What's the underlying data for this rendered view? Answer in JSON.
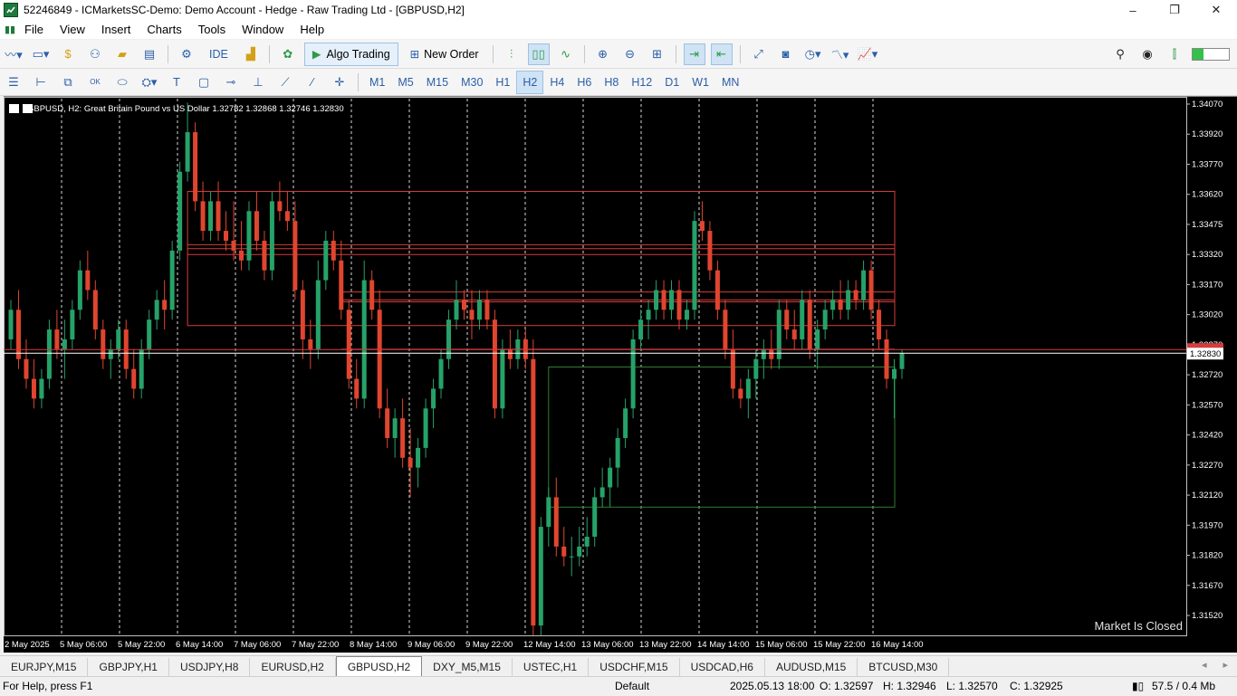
{
  "window": {
    "title": "52246849 - ICMarketsSC-Demo: Demo Account - Hedge - Raw Trading Ltd - [GBPUSD,H2]",
    "buttons": [
      "–",
      "❐",
      "✕"
    ]
  },
  "menu": [
    "File",
    "View",
    "Insert",
    "Charts",
    "Tools",
    "Window",
    "Help"
  ],
  "toolbar": {
    "ide_label": "IDE",
    "algo_label": "Algo Trading",
    "new_order_label": "New Order"
  },
  "timeframes": [
    "M1",
    "M5",
    "M15",
    "M30",
    "H1",
    "H2",
    "H4",
    "H6",
    "H8",
    "H12",
    "D1",
    "W1",
    "MN"
  ],
  "active_timeframe": "H2",
  "chart": {
    "header": "GBPUSD, H2:  Great Britain Pound vs US Dollar  1.32782 1.32868 1.32746 1.32830",
    "market_status": "Market Is Closed",
    "bid_label": "1.32830",
    "background": "#000000",
    "bull_color": "#26a269",
    "bear_color": "#e0452f"
  },
  "chart_data": {
    "type": "candlestick",
    "symbol": "GBPUSD",
    "timeframe": "H2",
    "ylim": [
      1.314,
      1.3412
    ],
    "y_ticks": [
      "1.34070",
      "1.33920",
      "1.33770",
      "1.33620",
      "1.33475",
      "1.33320",
      "1.33170",
      "1.33020",
      "1.32870",
      "1.32720",
      "1.32570",
      "1.32420",
      "1.32270",
      "1.32120",
      "1.31970",
      "1.31820",
      "1.31670",
      "1.31520"
    ],
    "x_ticks": [
      "2 May 2025",
      "5 May 06:00",
      "5 May 22:00",
      "6 May 14:00",
      "7 May 06:00",
      "7 May 22:00",
      "8 May 14:00",
      "9 May 06:00",
      "9 May 22:00",
      "12 May 14:00",
      "13 May 06:00",
      "13 May 22:00",
      "14 May 14:00",
      "15 May 06:00",
      "15 May 22:00",
      "16 May 14:00"
    ],
    "last_price": 1.3283,
    "candles": [
      [
        1.329,
        1.331,
        1.3285,
        1.3305
      ],
      [
        1.3305,
        1.3315,
        1.3275,
        1.328
      ],
      [
        1.328,
        1.329,
        1.3265,
        1.327
      ],
      [
        1.327,
        1.328,
        1.3255,
        1.326
      ],
      [
        1.326,
        1.3275,
        1.3255,
        1.327
      ],
      [
        1.327,
        1.33,
        1.3265,
        1.3295
      ],
      [
        1.3295,
        1.3305,
        1.328,
        1.3285
      ],
      [
        1.3285,
        1.33,
        1.327,
        1.329
      ],
      [
        1.329,
        1.331,
        1.3285,
        1.3305
      ],
      [
        1.3305,
        1.333,
        1.33,
        1.3325
      ],
      [
        1.3325,
        1.3335,
        1.331,
        1.3315
      ],
      [
        1.3315,
        1.332,
        1.329,
        1.3295
      ],
      [
        1.3295,
        1.33,
        1.3275,
        1.328
      ],
      [
        1.328,
        1.329,
        1.327,
        1.3285
      ],
      [
        1.3285,
        1.33,
        1.328,
        1.3295
      ],
      [
        1.3295,
        1.33,
        1.327,
        1.3275
      ],
      [
        1.3275,
        1.3285,
        1.326,
        1.3265
      ],
      [
        1.3265,
        1.329,
        1.326,
        1.3285
      ],
      [
        1.3285,
        1.3305,
        1.328,
        1.33
      ],
      [
        1.33,
        1.3315,
        1.3295,
        1.331
      ],
      [
        1.331,
        1.332,
        1.3295,
        1.3305
      ],
      [
        1.3305,
        1.334,
        1.33,
        1.3335
      ],
      [
        1.3335,
        1.338,
        1.333,
        1.3375
      ],
      [
        1.3375,
        1.341,
        1.337,
        1.3395
      ],
      [
        1.3395,
        1.34,
        1.3355,
        1.336
      ],
      [
        1.336,
        1.337,
        1.334,
        1.3345
      ],
      [
        1.3345,
        1.3365,
        1.334,
        1.336
      ],
      [
        1.336,
        1.337,
        1.334,
        1.3345
      ],
      [
        1.3345,
        1.3355,
        1.3335,
        1.334
      ],
      [
        1.334,
        1.336,
        1.333,
        1.3335
      ],
      [
        1.3335,
        1.335,
        1.3325,
        1.333
      ],
      [
        1.333,
        1.336,
        1.3325,
        1.3355
      ],
      [
        1.3355,
        1.3365,
        1.3335,
        1.334
      ],
      [
        1.334,
        1.3345,
        1.332,
        1.3325
      ],
      [
        1.3325,
        1.3365,
        1.332,
        1.336
      ],
      [
        1.336,
        1.337,
        1.335,
        1.3355
      ],
      [
        1.3355,
        1.3365,
        1.3345,
        1.335
      ],
      [
        1.335,
        1.336,
        1.331,
        1.3315
      ],
      [
        1.3315,
        1.332,
        1.328,
        1.329
      ],
      [
        1.329,
        1.33,
        1.3275,
        1.3285
      ],
      [
        1.3285,
        1.333,
        1.328,
        1.332
      ],
      [
        1.332,
        1.3345,
        1.3315,
        1.334
      ],
      [
        1.334,
        1.3345,
        1.3325,
        1.333
      ],
      [
        1.333,
        1.334,
        1.33,
        1.3305
      ],
      [
        1.3305,
        1.331,
        1.3265,
        1.327
      ],
      [
        1.327,
        1.328,
        1.3255,
        1.326
      ],
      [
        1.326,
        1.333,
        1.3255,
        1.332
      ],
      [
        1.332,
        1.3325,
        1.33,
        1.3305
      ],
      [
        1.3305,
        1.3315,
        1.325,
        1.3255
      ],
      [
        1.3255,
        1.3265,
        1.3235,
        1.324
      ],
      [
        1.324,
        1.3255,
        1.323,
        1.325
      ],
      [
        1.325,
        1.326,
        1.3225,
        1.323
      ],
      [
        1.323,
        1.3245,
        1.321,
        1.3225
      ],
      [
        1.3225,
        1.324,
        1.3215,
        1.3235
      ],
      [
        1.3235,
        1.326,
        1.323,
        1.3255
      ],
      [
        1.3255,
        1.327,
        1.3245,
        1.3265
      ],
      [
        1.3265,
        1.3285,
        1.326,
        1.328
      ],
      [
        1.328,
        1.3305,
        1.3275,
        1.33
      ],
      [
        1.33,
        1.332,
        1.3295,
        1.331
      ],
      [
        1.331,
        1.3315,
        1.33,
        1.3305
      ],
      [
        1.3305,
        1.3315,
        1.329,
        1.33
      ],
      [
        1.33,
        1.3315,
        1.3295,
        1.331
      ],
      [
        1.331,
        1.3315,
        1.3295,
        1.33
      ],
      [
        1.33,
        1.3305,
        1.325,
        1.3255
      ],
      [
        1.3255,
        1.329,
        1.325,
        1.3285
      ],
      [
        1.3285,
        1.3295,
        1.3275,
        1.328
      ],
      [
        1.328,
        1.3295,
        1.3275,
        1.329
      ],
      [
        1.329,
        1.3295,
        1.3275,
        1.328
      ],
      [
        1.328,
        1.329,
        1.314,
        1.3145
      ],
      [
        1.3145,
        1.32,
        1.314,
        1.3195
      ],
      [
        1.3195,
        1.3215,
        1.3185,
        1.321
      ],
      [
        1.321,
        1.322,
        1.318,
        1.3185
      ],
      [
        1.3185,
        1.3195,
        1.3175,
        1.318
      ],
      [
        1.318,
        1.319,
        1.317,
        1.318
      ],
      [
        1.318,
        1.3195,
        1.3175,
        1.3185
      ],
      [
        1.3185,
        1.32,
        1.318,
        1.319
      ],
      [
        1.319,
        1.3215,
        1.3185,
        1.321
      ],
      [
        1.321,
        1.3225,
        1.3205,
        1.3215
      ],
      [
        1.3215,
        1.323,
        1.3205,
        1.3225
      ],
      [
        1.3225,
        1.3245,
        1.3215,
        1.324
      ],
      [
        1.324,
        1.326,
        1.3235,
        1.3255
      ],
      [
        1.3255,
        1.3295,
        1.325,
        1.329
      ],
      [
        1.329,
        1.3305,
        1.3285,
        1.33
      ],
      [
        1.33,
        1.331,
        1.329,
        1.3305
      ],
      [
        1.3305,
        1.332,
        1.33,
        1.3315
      ],
      [
        1.3315,
        1.332,
        1.33,
        1.3305
      ],
      [
        1.3305,
        1.332,
        1.33,
        1.3315
      ],
      [
        1.3315,
        1.332,
        1.3295,
        1.33
      ],
      [
        1.33,
        1.331,
        1.3295,
        1.3305
      ],
      [
        1.3305,
        1.3355,
        1.33,
        1.335
      ],
      [
        1.335,
        1.336,
        1.334,
        1.3345
      ],
      [
        1.3345,
        1.335,
        1.332,
        1.3325
      ],
      [
        1.3325,
        1.333,
        1.33,
        1.3305
      ],
      [
        1.3305,
        1.331,
        1.328,
        1.3285
      ],
      [
        1.3285,
        1.3295,
        1.326,
        1.3265
      ],
      [
        1.3265,
        1.327,
        1.3255,
        1.326
      ],
      [
        1.326,
        1.3275,
        1.325,
        1.327
      ],
      [
        1.327,
        1.3285,
        1.326,
        1.328
      ],
      [
        1.328,
        1.329,
        1.327,
        1.3285
      ],
      [
        1.3285,
        1.3295,
        1.3275,
        1.328
      ],
      [
        1.328,
        1.331,
        1.3275,
        1.3305
      ],
      [
        1.3305,
        1.331,
        1.329,
        1.3295
      ],
      [
        1.3295,
        1.3305,
        1.3285,
        1.329
      ],
      [
        1.329,
        1.3315,
        1.3285,
        1.331
      ],
      [
        1.331,
        1.3315,
        1.328,
        1.3285
      ],
      [
        1.3285,
        1.33,
        1.3275,
        1.3295
      ],
      [
        1.3295,
        1.331,
        1.329,
        1.3305
      ],
      [
        1.3305,
        1.3315,
        1.33,
        1.331
      ],
      [
        1.331,
        1.332,
        1.33,
        1.3305
      ],
      [
        1.3305,
        1.332,
        1.33,
        1.3315
      ],
      [
        1.3315,
        1.332,
        1.3305,
        1.331
      ],
      [
        1.331,
        1.333,
        1.3305,
        1.3325
      ],
      [
        1.3325,
        1.333,
        1.33,
        1.3305
      ],
      [
        1.3305,
        1.331,
        1.3285,
        1.329
      ],
      [
        1.329,
        1.3295,
        1.3265,
        1.327
      ],
      [
        1.327,
        1.328,
        1.325,
        1.3275
      ],
      [
        1.3275,
        1.3285,
        1.327,
        1.3283
      ]
    ],
    "zones": [
      {
        "top": 1.3365,
        "bottom": 1.3297,
        "color": "#d63c3c"
      },
      {
        "top": 1.3276,
        "bottom": 1.3205,
        "color": "#2f7d32"
      }
    ],
    "hlines": [
      {
        "value": 1.3338,
        "color": "#d63c3c"
      },
      {
        "value": 1.3336,
        "color": "#d63c3c"
      },
      {
        "value": 1.3333,
        "color": "#d63c3c"
      },
      {
        "value": 1.3314,
        "color": "#d63c3c"
      },
      {
        "value": 1.331,
        "color": "#d63c3c"
      },
      {
        "value": 1.3309,
        "color": "#d63c3c"
      },
      {
        "value": 1.3285,
        "color": "#d63c3c"
      }
    ]
  },
  "tabs": [
    "EURJPY,M15",
    "GBPJPY,H1",
    "USDJPY,H8",
    "EURUSD,H2",
    "GBPUSD,H2",
    "DXY_M5,M15",
    "USTEC,H1",
    "USDCHF,M15",
    "USDCAD,H6",
    "AUDUSD,M15",
    "BTCUSD,M30"
  ],
  "active_tab": "GBPUSD,H2",
  "status": {
    "help": "For Help, press F1",
    "profile": "Default",
    "datetime": "2025.05.13 18:00",
    "open": "O: 1.32597",
    "high": "H: 1.32946",
    "low": "L: 1.32570",
    "close": "C: 1.32925",
    "traffic": "57.5 / 0.4 Mb"
  }
}
